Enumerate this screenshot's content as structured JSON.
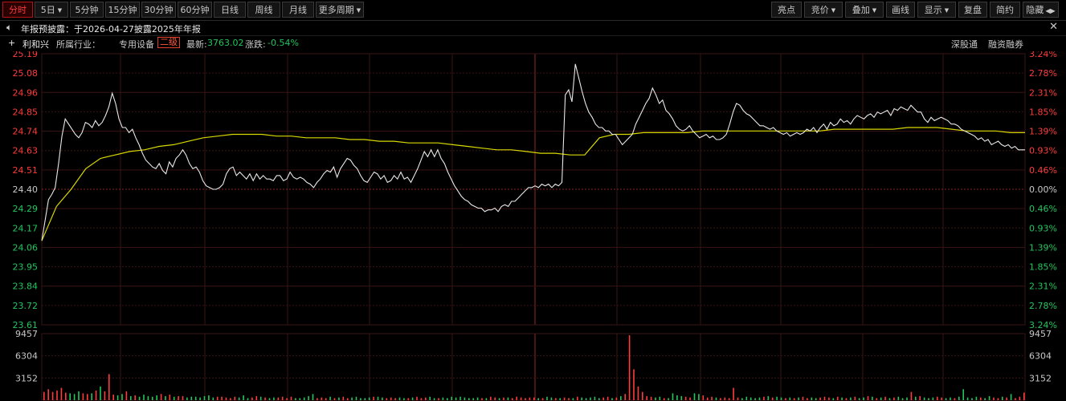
{
  "toolbar": {
    "left": [
      {
        "label": "分时",
        "active": true
      },
      {
        "label": "5日",
        "dropdown": true
      },
      {
        "label": "5分钟"
      },
      {
        "label": "15分钟"
      },
      {
        "label": "30分钟"
      },
      {
        "label": "60分钟"
      },
      {
        "label": "日线"
      },
      {
        "label": "周线"
      },
      {
        "label": "月线"
      },
      {
        "label": "更多周期",
        "dropdown": true
      }
    ],
    "right": [
      {
        "label": "亮点"
      },
      {
        "label": "竞价",
        "dropdown": true
      },
      {
        "label": "叠加",
        "dropdown": true
      },
      {
        "label": "画线"
      },
      {
        "label": "显示",
        "dropdown": true
      },
      {
        "label": "复盘"
      },
      {
        "label": "简约"
      },
      {
        "label": "隐藏",
        "arrows": "◀▶"
      }
    ]
  },
  "notice": {
    "text": "年报预披露：于2026-04-27披露2025年年报",
    "speaker_icon": "speaker-icon",
    "close_icon": "close-icon"
  },
  "info": {
    "stock_name": "利和兴",
    "industry_label": "所属行业：",
    "industry": "专用设备",
    "grade": "二级",
    "latest_label": "最新:",
    "latest_value": "3763.02",
    "change_label": "涨跌:",
    "change_value": "-0.54%",
    "link_1": "深股通",
    "link_2": "融资融券"
  },
  "colors": {
    "up": "#ff3b3b",
    "down": "#22c55e",
    "neutral": "#c8c8c8",
    "price_line": "#e8e8e8",
    "avg_line": "#d8d800",
    "grid": "#3a1414"
  },
  "chart_data": {
    "type": "line",
    "price_ticks": [
      "25.19",
      "25.08",
      "24.96",
      "24.85",
      "24.74",
      "24.63",
      "24.51",
      "24.40",
      "24.29",
      "24.17",
      "24.06",
      "23.95",
      "23.84",
      "23.72",
      "23.61"
    ],
    "pct_ticks": [
      "3.24%",
      "2.78%",
      "2.31%",
      "1.85%",
      "1.39%",
      "0.93%",
      "0.46%",
      "0.00%",
      "0.46%",
      "0.93%",
      "1.39%",
      "1.85%",
      "2.31%",
      "2.78%",
      "3.24%"
    ],
    "ylim": [
      23.61,
      25.19
    ],
    "prev_close": 24.4,
    "volume_ticks": [
      "9457",
      "6304",
      "3152"
    ],
    "volume_max": 9457,
    "series": [
      {
        "values": [
          24.1,
          24.22,
          24.34,
          24.37,
          24.41,
          24.55,
          24.71,
          24.81,
          24.78,
          24.75,
          24.72,
          24.7,
          24.73,
          24.79,
          24.78,
          24.76,
          24.8,
          24.77,
          24.79,
          24.83,
          24.88,
          24.96,
          24.9,
          24.81,
          24.76,
          24.76,
          24.73,
          24.75,
          24.7,
          24.66,
          24.61,
          24.57,
          24.55,
          24.53,
          24.52,
          24.55,
          24.51,
          24.49,
          24.56,
          24.53,
          24.58,
          24.6,
          24.63,
          24.6,
          24.55,
          24.52,
          24.53,
          24.5,
          24.45,
          24.42,
          24.41,
          24.4,
          24.4,
          24.41,
          24.43,
          24.49,
          24.52,
          24.53,
          24.48,
          24.5,
          24.48,
          24.46,
          24.49,
          24.45,
          24.49,
          24.46,
          24.48,
          24.46,
          24.46,
          24.45,
          24.48,
          24.48,
          24.45,
          24.46,
          24.5,
          24.47,
          24.46,
          24.47,
          24.46,
          24.44,
          24.43,
          24.41,
          24.44,
          24.46,
          24.49,
          24.51,
          24.5,
          24.53,
          24.47,
          24.52,
          24.55,
          24.58,
          24.57,
          24.54,
          24.52,
          24.48,
          24.45,
          24.44,
          24.47,
          24.5,
          24.49,
          24.46,
          24.48,
          24.44,
          24.45,
          24.48,
          24.46,
          24.5,
          24.46,
          24.47,
          24.44,
          24.48,
          24.52,
          24.57,
          24.62,
          24.59,
          24.63,
          24.59,
          24.63,
          24.58,
          24.55,
          24.5,
          24.46,
          24.42,
          24.39,
          24.36,
          24.34,
          24.33,
          24.31,
          24.3,
          24.29,
          24.29,
          24.27,
          24.28,
          24.28,
          24.29,
          24.27,
          24.3,
          24.31,
          24.3,
          24.33,
          24.33,
          24.35,
          24.37,
          24.39,
          24.41,
          24.41,
          24.42,
          24.41,
          24.43,
          24.42,
          24.43,
          24.41,
          24.43,
          24.42,
          24.44,
          24.95,
          24.98,
          24.91,
          25.13,
          25.05,
          24.97,
          24.9,
          24.85,
          24.82,
          24.78,
          24.76,
          24.76,
          24.74,
          24.74,
          24.72,
          24.72,
          24.69,
          24.66,
          24.68,
          24.7,
          24.72,
          24.78,
          24.82,
          24.86,
          24.9,
          24.93,
          24.99,
          24.95,
          24.9,
          24.92,
          24.86,
          24.84,
          24.81,
          24.77,
          24.75,
          24.74,
          24.75,
          24.77,
          24.74,
          24.72,
          24.7,
          24.71,
          24.72,
          24.7,
          24.71,
          24.69,
          24.69,
          24.7,
          24.72,
          24.78,
          24.85,
          24.9,
          24.89,
          24.86,
          24.84,
          24.83,
          24.81,
          24.79,
          24.77,
          24.77,
          24.76,
          24.75,
          24.76,
          24.74,
          24.73,
          24.72,
          24.73,
          24.71,
          24.72,
          24.73,
          24.72,
          24.73,
          24.75,
          24.74,
          24.76,
          24.73,
          24.76,
          24.78,
          24.75,
          24.79,
          24.77,
          24.78,
          24.81,
          24.79,
          24.8,
          24.78,
          24.81,
          24.83,
          24.82,
          24.81,
          24.83,
          24.84,
          24.82,
          24.85,
          24.84,
          24.85,
          24.86,
          24.83,
          24.87,
          24.86,
          24.88,
          24.87,
          24.86,
          24.89,
          24.87,
          24.85,
          24.85,
          24.81,
          24.79,
          24.82,
          24.8,
          24.81,
          24.82,
          24.81,
          24.8,
          24.78,
          24.78,
          24.77,
          24.75,
          24.74,
          24.73,
          24.72,
          24.71,
          24.69,
          24.7,
          24.68,
          24.69,
          24.66,
          24.67,
          24.68,
          24.66,
          24.65,
          24.66,
          24.64,
          24.65,
          24.63,
          24.63,
          24.63
        ]
      },
      {
        "values": [
          24.1,
          24.3,
          24.4,
          24.52,
          24.58,
          24.6,
          24.62,
          24.63,
          24.65,
          24.66,
          24.68,
          24.7,
          24.71,
          24.72,
          24.72,
          24.72,
          24.71,
          24.71,
          24.7,
          24.7,
          24.7,
          24.69,
          24.69,
          24.68,
          24.68,
          24.67,
          24.67,
          24.67,
          24.66,
          24.65,
          24.64,
          24.63,
          24.63,
          24.62,
          24.61,
          24.61,
          24.6,
          24.6,
          24.7,
          24.72,
          24.72,
          24.73,
          24.73,
          24.73,
          24.73,
          24.74,
          24.74,
          24.74,
          24.74,
          24.74,
          24.74,
          24.74,
          24.74,
          24.74,
          24.75,
          24.75,
          24.75,
          24.75,
          24.75,
          24.76,
          24.76,
          24.76,
          24.75,
          24.74,
          24.74,
          24.74,
          24.73,
          24.73
        ]
      }
    ],
    "volumes": [
      1200,
      1600,
      1200,
      1400,
      1800,
      1100,
      1000,
      900,
      1300,
      1000,
      900,
      1000,
      1400,
      2000,
      1300,
      3800,
      800,
      700,
      900,
      1300,
      600,
      700,
      500,
      800,
      600,
      500,
      700,
      900,
      600,
      800,
      500,
      600,
      600,
      400,
      500,
      500,
      400,
      600,
      700,
      400,
      500,
      500,
      400,
      300,
      500,
      400,
      700,
      300,
      400,
      600,
      500,
      400,
      300,
      400,
      400,
      500,
      300,
      500,
      300,
      300,
      400,
      600,
      900,
      300,
      400,
      300,
      500,
      300,
      400,
      500,
      300,
      400,
      500,
      300,
      300,
      400,
      500,
      500,
      400,
      300,
      400,
      300,
      400,
      300,
      300,
      400,
      500,
      300,
      400,
      500,
      300,
      300,
      400,
      300,
      500,
      400,
      500,
      400,
      300,
      300,
      400,
      300,
      300,
      500,
      400,
      300,
      400,
      400,
      300,
      500,
      400,
      300,
      400,
      400,
      300,
      300,
      500,
      400,
      300,
      300,
      400,
      300,
      300,
      500,
      400,
      300,
      400,
      500,
      300,
      400,
      500,
      300,
      400,
      600,
      900,
      9457,
      4500,
      2000,
      1200,
      600,
      500,
      400,
      500,
      300,
      300,
      1000,
      700,
      600,
      500,
      400,
      1000,
      900,
      700,
      400,
      500,
      400,
      300,
      400,
      300,
      1800,
      400,
      300,
      500,
      400,
      300,
      400,
      500,
      600,
      400,
      500,
      400,
      300,
      400,
      300,
      400,
      500,
      300,
      400,
      300,
      400,
      500,
      400,
      300,
      500,
      400,
      300,
      400,
      500,
      300,
      400,
      600,
      500,
      300,
      400,
      500,
      300,
      400,
      500,
      300,
      400,
      1200,
      500,
      600,
      400,
      300,
      400,
      500,
      400,
      300,
      400,
      300,
      500,
      1600,
      400,
      300,
      500,
      400,
      300,
      600,
      400,
      300,
      500,
      400,
      900,
      300,
      500,
      1100
    ]
  }
}
